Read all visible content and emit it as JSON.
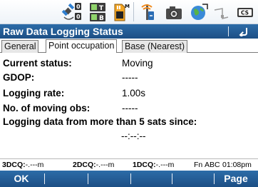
{
  "toolbar": {
    "icons": [
      {
        "name": "satellite-tracking-icon",
        "caption_top": "0",
        "caption_bottom": "0"
      },
      {
        "name": "battery-memory-icon",
        "caption_top": "T",
        "caption_bottom": "B"
      },
      {
        "name": "sd-card-icon",
        "caption_top": "M"
      },
      {
        "name": "antenna-rtk-icon"
      },
      {
        "name": "camera-icon"
      },
      {
        "name": "globe-network-icon"
      },
      {
        "name": "line-measure-icon"
      },
      {
        "name": "keyboard-cs-icon",
        "caption": "CS"
      }
    ]
  },
  "title": {
    "text": "Raw Data Logging Status"
  },
  "tabs": [
    {
      "label": "General",
      "active": false
    },
    {
      "label": "Point occupation",
      "active": true
    },
    {
      "label": "Base (Nearest)",
      "active": false
    }
  ],
  "rows": [
    {
      "label": "Current status:",
      "value": "Moving"
    },
    {
      "label": "GDOP:",
      "value": "-----"
    },
    {
      "label": "Logging rate:",
      "value": "1.00s"
    },
    {
      "label": "No. of moving obs:",
      "value": "-----"
    }
  ],
  "since": {
    "label": "Logging data from more than 5 sats since:",
    "value": "--:--:--"
  },
  "statusbar": {
    "dcq3_label": "3DCQ:",
    "dcq3_value": "-.---m",
    "dcq2_label": "2DCQ:",
    "dcq2_value": "-.---m",
    "dcq1_label": "1DCQ:",
    "dcq1_value": "-.---m",
    "fn": "Fn",
    "mode": "ABC",
    "time": "01:08pm"
  },
  "softkeys": {
    "f1": "OK",
    "f2": "",
    "f3": "",
    "f4": "",
    "f5": "",
    "f6": "Page"
  },
  "colors": {
    "bar_blue": "#1d4f85",
    "bar_blue_light": "#2c6ca8"
  }
}
